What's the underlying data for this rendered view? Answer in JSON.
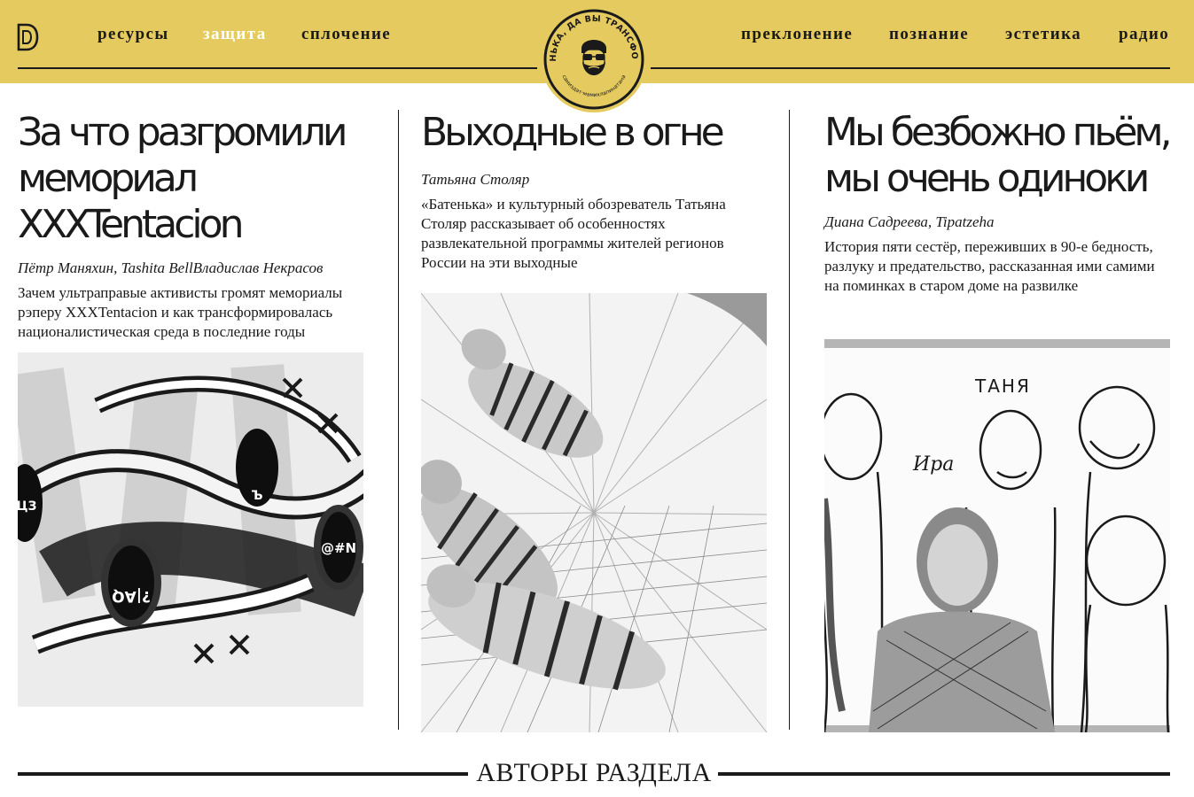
{
  "brand": {
    "badge_text_top": "БАТЕНЬКА, ДА ВЫ ТРАНСФОРМЕР",
    "badge_text_bottom": "самиздат·мамихлапинатана",
    "colors": {
      "header": "#e5cb5f",
      "ink": "#1a1a1a",
      "active": "#ffffff"
    }
  },
  "nav": {
    "left": [
      "ресурсы",
      "защита",
      "сплочение"
    ],
    "right": [
      "преклонение",
      "познание",
      "эстетика",
      "радио"
    ],
    "active": "защита"
  },
  "articles": [
    {
      "title_line1": "За что разгромили",
      "title_line2": "мемориал XXXTentacion",
      "authors": "Пётр Маняхин, Tashita BellВладислав Некрасов",
      "lead": "Зачем ультраправые активисты громят мемориалы рэперу XXXTentacion и как трансформировалась националистическая среда в последние годы",
      "image_icon": "xxxtentacion-collage-image",
      "image_texts": [
        "?|AQ",
        "@#N",
        "ЦЗ",
        "Ъ"
      ]
    },
    {
      "title_line1": "Выходные в огне",
      "title_line2": "",
      "authors": "Татьяна Столяр",
      "lead": "«Батенька» и культурный обозреватель Татьяна Столяр рассказывает об особенностях развлекательной программы жителей регионов России на эти выходные",
      "image_icon": "tigers-collage-image"
    },
    {
      "title_line1": "Мы безбожно пьём,",
      "title_line2": "мы очень одиноки",
      "authors": "Диана Садреева, Tipatzeha",
      "lead": "История пяти сестёр, переживших в 90-е бедность, разлуку и предательство, рассказанная ими самими на поминках в старом доме на развилке",
      "image_icon": "sisters-drawing-image",
      "image_texts": [
        "ТАНЯ",
        "Ира"
      ]
    }
  ],
  "footer": {
    "section_title": "АВТОРЫ РАЗДЕЛА"
  }
}
